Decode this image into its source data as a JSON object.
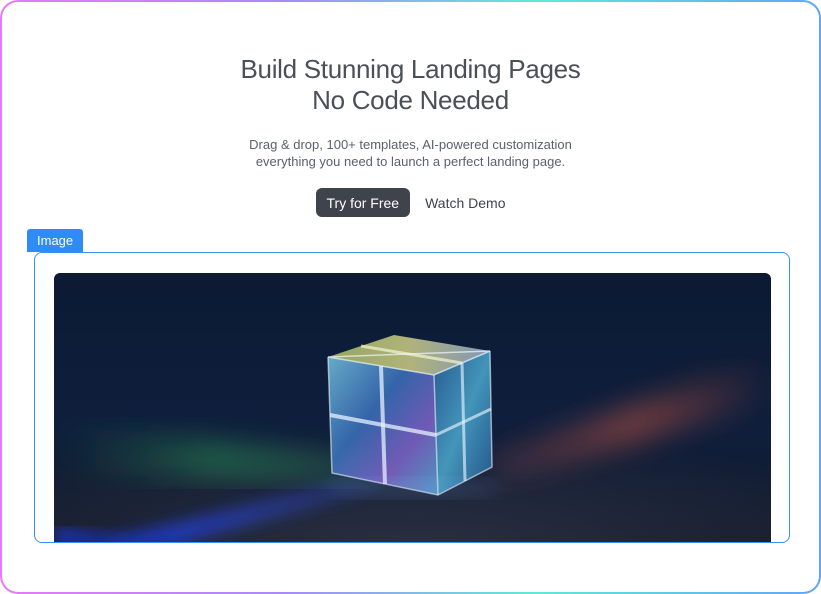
{
  "hero": {
    "title_line1": "Build Stunning Landing Pages",
    "title_line2": "No Code Needed",
    "subtitle_line1": "Drag & drop, 100+ templates, AI-powered customization",
    "subtitle_line2": "everything you need to launch a perfect landing page."
  },
  "actions": {
    "primary_label": "Try for Free",
    "secondary_label": "Watch Demo"
  },
  "image_block": {
    "tag_label": "Image",
    "subject": "glass prism cube on dark surface with spectral light"
  },
  "colors": {
    "frame_gradient": [
      "#e879f9",
      "#a78bfa",
      "#5eead4",
      "#60a5fa"
    ],
    "accent_blue": "#2f8cf7",
    "primary_button": "#3f434c",
    "text": "#4b4f58"
  }
}
